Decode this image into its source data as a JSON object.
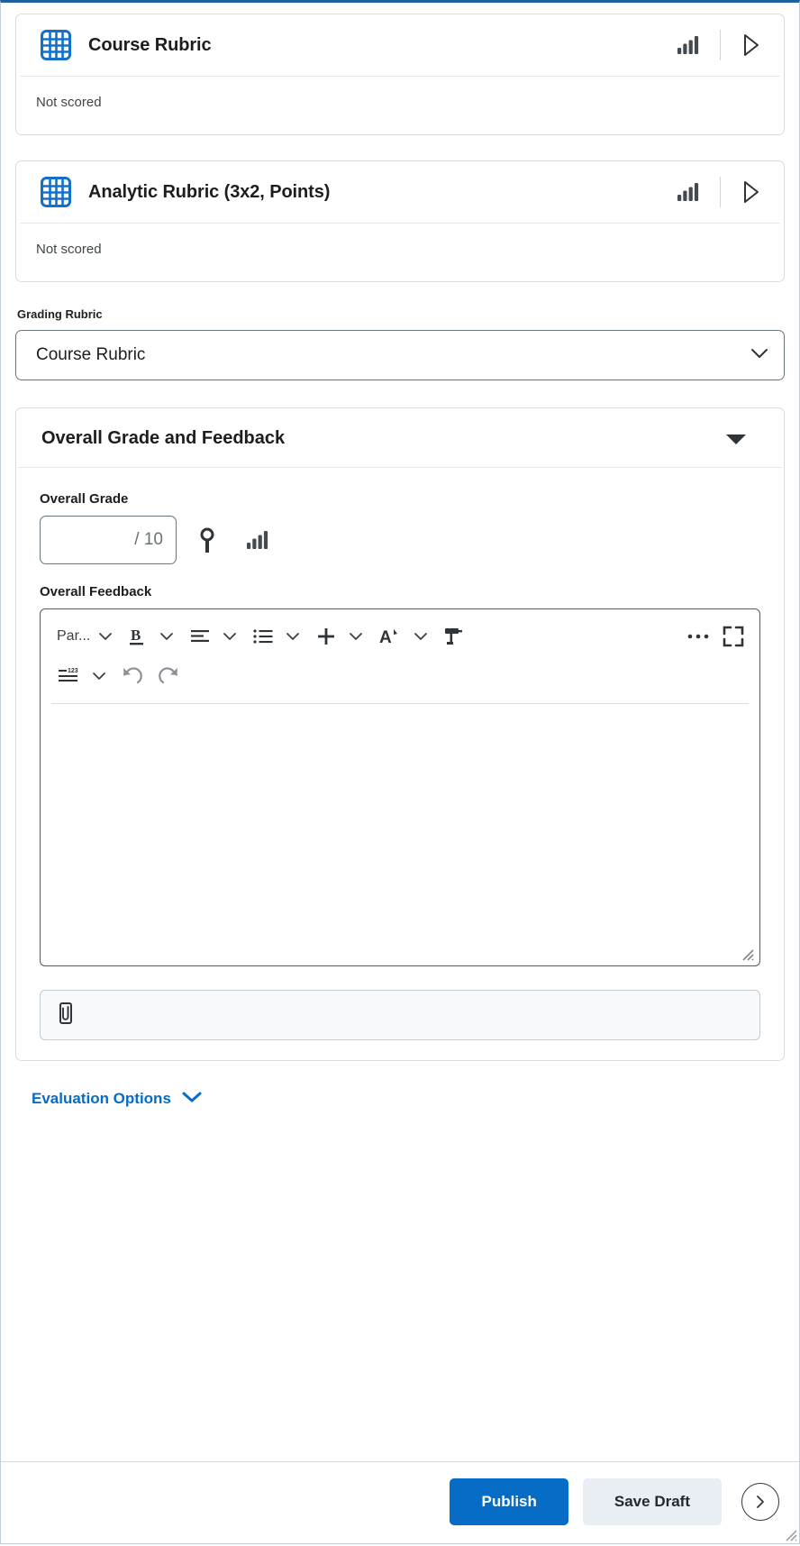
{
  "colors": {
    "accent": "#066cc5",
    "rubric_icon": "#1571c6",
    "text": "#1c1d1f",
    "muted": "#6a7276",
    "border": "#d5dde3",
    "top_bar": "#1f5f9e"
  },
  "rubrics": [
    {
      "title": "Course Rubric",
      "status": "Not scored",
      "grid_icon": "rubric-grid-icon",
      "stats_icon": "bar-chart-icon",
      "expand_icon": "triangle-right-icon"
    },
    {
      "title": "Analytic Rubric (3x2, Points)",
      "status": "Not scored",
      "grid_icon": "rubric-grid-icon",
      "stats_icon": "bar-chart-icon",
      "expand_icon": "triangle-right-icon"
    }
  ],
  "grading_rubric": {
    "label": "Grading Rubric",
    "selected": "Course Rubric",
    "options": [
      "Course Rubric",
      "Analytic Rubric (3x2, Points)"
    ],
    "chevron_icon": "chevron-down-icon"
  },
  "overall": {
    "panel_title": "Overall Grade and Feedback",
    "collapse_icon": "triangle-down-icon",
    "grade_label": "Overall Grade",
    "grade_value": "",
    "grade_placeholder": "",
    "grade_denominator": "/ 10",
    "rubric_btn_icon": "award-ribbon-icon",
    "stats_btn_icon": "bar-chart-icon",
    "feedback_label": "Overall Feedback"
  },
  "editor": {
    "toolbar_row1": [
      {
        "name": "format-paragraph-dropdown",
        "label": "Par...",
        "icon": "text-format-icon",
        "caret": true
      },
      {
        "name": "bold-button",
        "label": "",
        "icon": "bold-icon",
        "caret": true
      },
      {
        "name": "align-button",
        "label": "",
        "icon": "align-left-icon",
        "caret": true
      },
      {
        "name": "list-button",
        "label": "",
        "icon": "bulleted-list-icon",
        "caret": true
      },
      {
        "name": "insert-button",
        "label": "",
        "icon": "plus-icon",
        "caret": true
      },
      {
        "name": "font-style-button",
        "label": "",
        "icon": "font-accent-icon",
        "caret": true
      },
      {
        "name": "format-painter-button",
        "label": "",
        "icon": "paint-roller-icon",
        "caret": false
      },
      {
        "name": "more-options-button",
        "label": "",
        "icon": "ellipsis-icon",
        "caret": false
      },
      {
        "name": "fullscreen-button",
        "label": "",
        "icon": "expand-fullscreen-icon",
        "caret": false
      }
    ],
    "toolbar_row2": [
      {
        "name": "word-count-dropdown",
        "label": "",
        "icon": "lines-123-icon",
        "caret": true
      },
      {
        "name": "undo-button",
        "label": "",
        "icon": "undo-icon",
        "caret": false
      },
      {
        "name": "redo-button",
        "label": "",
        "icon": "redo-icon",
        "caret": false
      }
    ],
    "content": "",
    "placeholder": "",
    "resize_handle_icon": "resize-grip-icon"
  },
  "attachment": {
    "icon": "paperclip-icon",
    "label": ""
  },
  "evaluation_options": {
    "label": "Evaluation Options",
    "chevron_icon": "chevron-down-icon"
  },
  "footer": {
    "publish_label": "Publish",
    "save_draft_label": "Save Draft",
    "next_icon": "circle-arrow-right-icon",
    "window_grip_icon": "resize-grip-icon"
  }
}
